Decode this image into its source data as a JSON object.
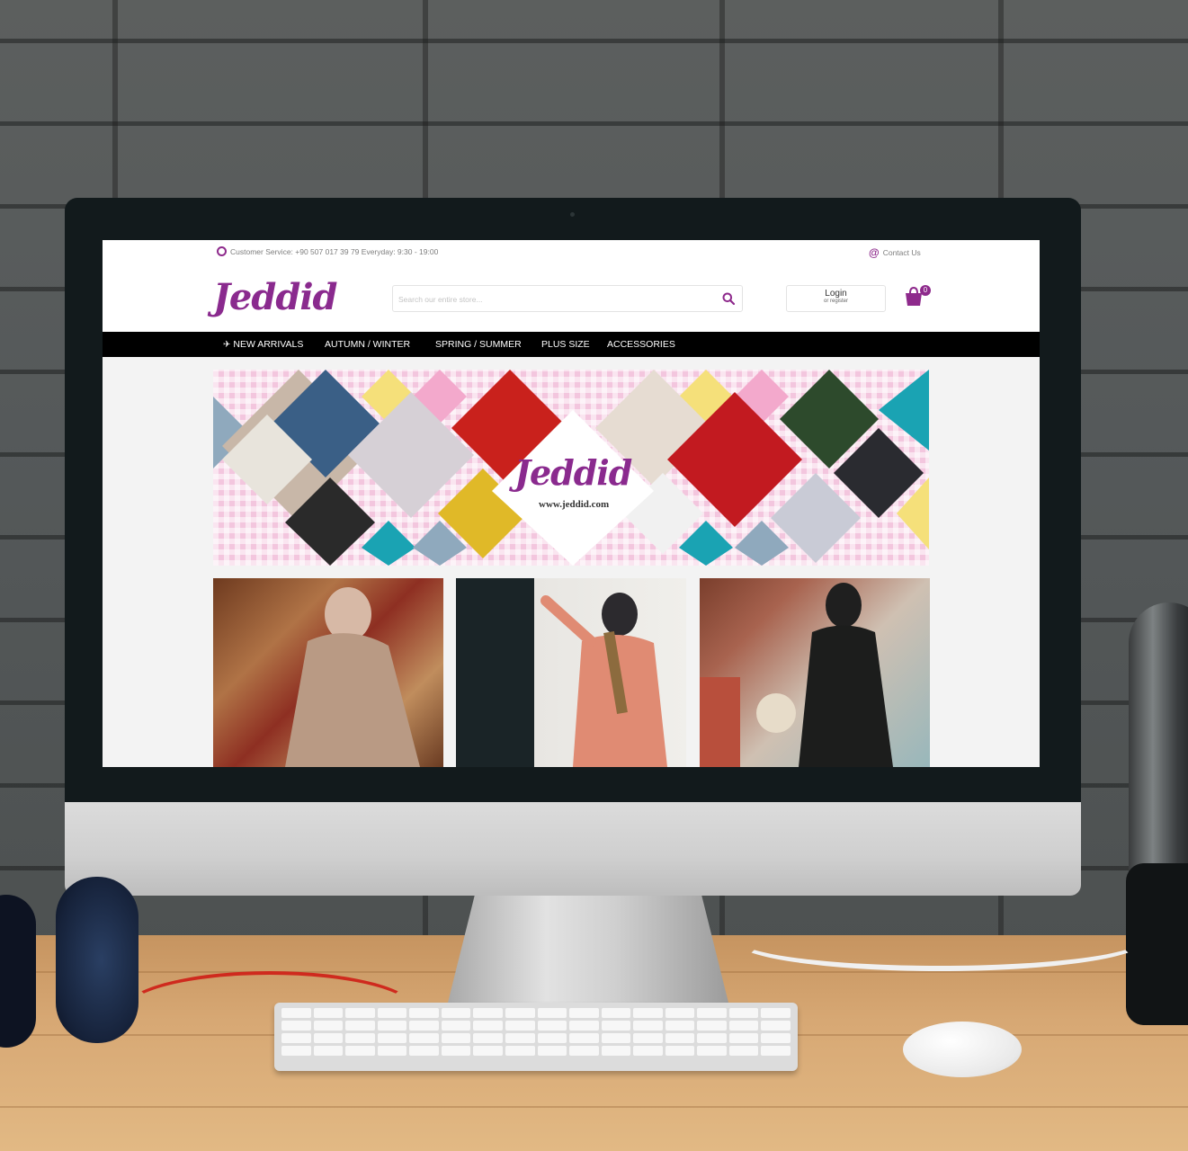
{
  "topbar": {
    "service_text": "Customer Service: +90 507 017 39 79 Everyday: 9:30 - 19:00",
    "contact_text": "Contact Us"
  },
  "header": {
    "logo_text": "Jeddid",
    "search_placeholder": "Search our entire store...",
    "login_label": "Login",
    "login_sub": "or register",
    "cart_count": "0"
  },
  "nav": {
    "items": [
      {
        "label": "NEW ARRIVALS",
        "icon": "plane-icon"
      },
      {
        "label": "AUTUMN / WINTER"
      },
      {
        "label": "SPRING / SUMMER"
      },
      {
        "label": "PLUS SIZE"
      },
      {
        "label": "ACCESSORIES"
      }
    ]
  },
  "banner": {
    "logo_text": "Jeddid",
    "url_text": "www.jeddid.com"
  },
  "colors": {
    "brand": "#8a2a8e",
    "nav_bg": "#000000",
    "banner_pink": "#f3c6de",
    "banner_teal": "#1aa3b3",
    "banner_yellow": "#f5e07a",
    "banner_slate": "#8fa9bd"
  }
}
